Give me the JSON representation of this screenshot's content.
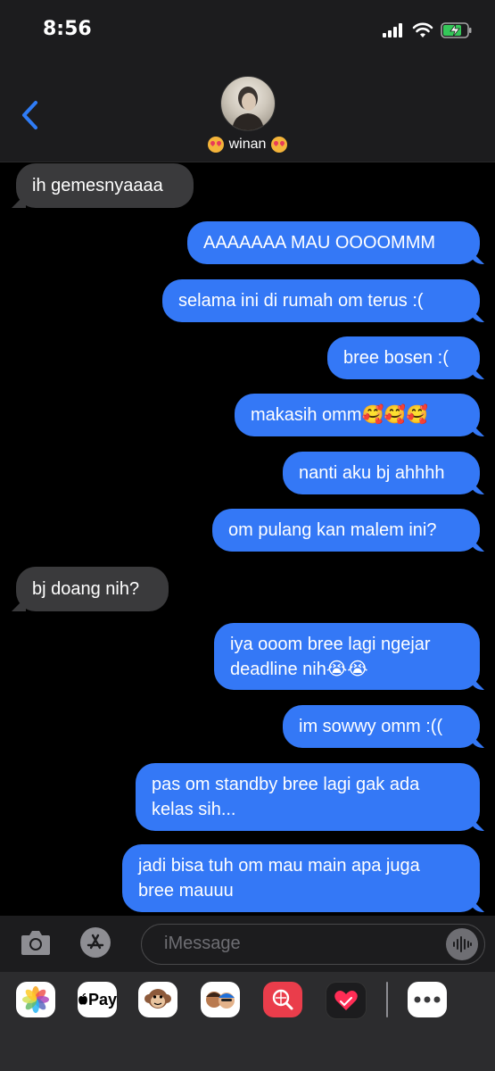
{
  "status_bar": {
    "time": "8:56"
  },
  "contact": {
    "name": "winan"
  },
  "messages": [
    {
      "from": "them",
      "text": "ih gemesnyaaaa"
    },
    {
      "from": "me",
      "text": "AAAAAAA MAU OOOOMMM"
    },
    {
      "from": "me",
      "text": "selama ini di rumah om terus :("
    },
    {
      "from": "me",
      "text": "bree bosen :("
    },
    {
      "from": "me",
      "text": "makasih omm🥰🥰🥰"
    },
    {
      "from": "me",
      "text": "nanti aku bj ahhhh"
    },
    {
      "from": "me",
      "text": "om pulang kan malem ini?"
    },
    {
      "from": "them",
      "text": "bj doang nih?"
    },
    {
      "from": "me",
      "text": "iya ooom bree lagi ngejar\ndeadline nih😭😭"
    },
    {
      "from": "me",
      "text": "im sowwy omm :(("
    },
    {
      "from": "me",
      "text": "pas om standby bree lagi gak ada\nkelas sih..."
    },
    {
      "from": "me",
      "text": "jadi bisa tuh om mau main apa juga\nbree mauuu"
    }
  ],
  "input": {
    "placeholder": "iMessage"
  },
  "app_tray": {
    "pay_label": "Pay"
  },
  "colors": {
    "outgoing_bubble": "#3478f6",
    "incoming_bubble": "#3a3a3c",
    "accent": "#2f7cf6"
  },
  "icons": [
    "back-chevron-icon",
    "camera-icon",
    "app-store-icon",
    "audio-waveform-icon",
    "photos-app-icon",
    "apple-pay-icon",
    "memoji-monkey-icon",
    "memoji-people-icon",
    "image-search-icon",
    "digital-touch-heart-icon",
    "more-apps-icon"
  ]
}
